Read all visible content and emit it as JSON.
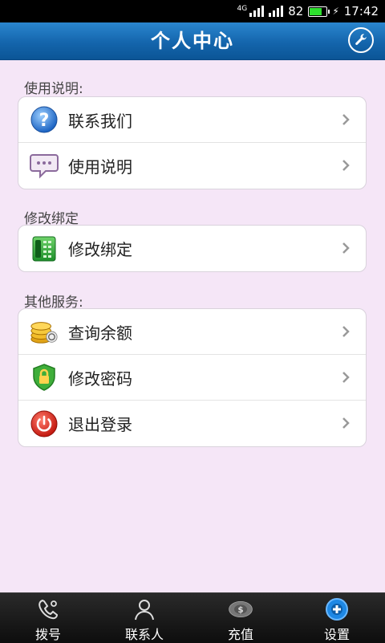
{
  "status_bar": {
    "network": "4G",
    "battery_level": "82",
    "time": "17:42",
    "battery_fill": 0.82
  },
  "header": {
    "title": "个人中心",
    "settings_icon": "wrench-icon"
  },
  "sections": [
    {
      "title": "使用说明:",
      "items": [
        {
          "label": "联系我们",
          "icon": "help-icon"
        },
        {
          "label": "使用说明",
          "icon": "chat-icon"
        }
      ]
    },
    {
      "title": "修改绑定",
      "items": [
        {
          "label": "修改绑定",
          "icon": "phone-icon"
        }
      ]
    },
    {
      "title": "其他服务:",
      "items": [
        {
          "label": "查询余额",
          "icon": "coins-icon"
        },
        {
          "label": "修改密码",
          "icon": "lock-shield-icon"
        },
        {
          "label": "退出登录",
          "icon": "power-icon"
        }
      ]
    }
  ],
  "tabs": [
    {
      "label": "拨号",
      "icon": "dial-icon"
    },
    {
      "label": "联系人",
      "icon": "contacts-icon"
    },
    {
      "label": "充值",
      "icon": "recharge-icon"
    },
    {
      "label": "设置",
      "icon": "settings-icon",
      "active": true
    }
  ],
  "colors": {
    "header_blue": "#1465ac",
    "background": "#f5e6f7",
    "active_tab": "#1e88e5"
  }
}
